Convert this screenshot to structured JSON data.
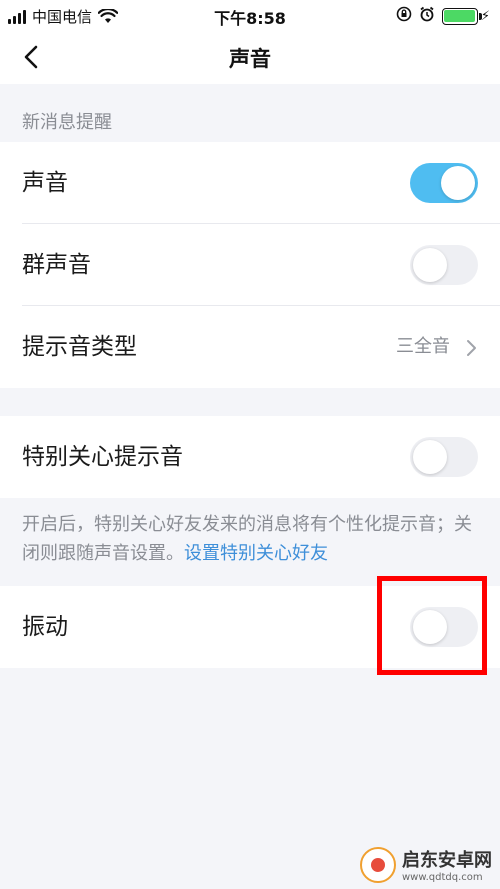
{
  "status_bar": {
    "carrier": "中国电信",
    "time": "下午8:58",
    "battery_level": 1.0,
    "battery_color": "#4cd964"
  },
  "nav": {
    "title": "声音",
    "back_icon": "chevron-left-icon"
  },
  "section_new_message": {
    "header": "新消息提醒",
    "rows": [
      {
        "label": "声音",
        "control": "toggle",
        "on": true
      },
      {
        "label": "群声音",
        "control": "toggle",
        "on": false
      },
      {
        "label": "提示音类型",
        "control": "value",
        "value": "三全音"
      }
    ]
  },
  "section_special": {
    "rows": [
      {
        "label": "特别关心提示音",
        "control": "toggle",
        "on": false
      }
    ],
    "note": "开启后，特别关心好友发来的消息将有个性化提示音；关闭则跟随声音设置。",
    "note_link": "设置特别关心好友"
  },
  "section_vibrate": {
    "rows": [
      {
        "label": "振动",
        "control": "toggle",
        "on": false
      }
    ]
  },
  "annotation": {
    "highlight_color": "#ff0000",
    "target": "振动 toggle"
  },
  "watermark": {
    "name": "启东安卓网",
    "url": "www.qdtdq.com"
  },
  "colors": {
    "toggle_on": "#4fbdf1",
    "toggle_off": "#eeeff3",
    "link": "#3e8fd9",
    "background": "#f4f5f9"
  }
}
